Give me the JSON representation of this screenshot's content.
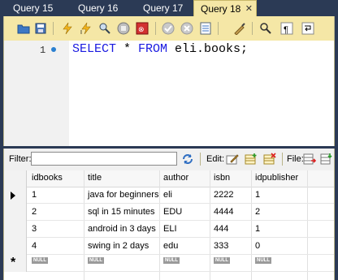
{
  "tabs": [
    {
      "label": "Query 15",
      "active": false
    },
    {
      "label": "Query 16",
      "active": false
    },
    {
      "label": "Query 17",
      "active": false
    },
    {
      "label": "Query 18",
      "active": true
    }
  ],
  "editor": {
    "line_number": "1",
    "code_keyword_select": "SELECT",
    "code_star": " * ",
    "code_keyword_from": "FROM",
    "code_table": " eli.books;"
  },
  "result": {
    "filter_label": "Filter:",
    "filter_value": "",
    "edit_label": "Edit:",
    "file_label": "File:",
    "columns": [
      "idbooks",
      "title",
      "author",
      "isbn",
      "idpublisher"
    ],
    "rows": [
      [
        "1",
        "java for beginners",
        "eli",
        "2222",
        "1"
      ],
      [
        "2",
        "sql in 15 minutes",
        "EDU",
        "4444",
        "2"
      ],
      [
        "3",
        "android in 3 days",
        "ELI",
        "444",
        "1"
      ],
      [
        "4",
        "swing in 2 days",
        "edu",
        "333",
        "0"
      ]
    ],
    "null_label": "NULL",
    "new_row_marker": "*"
  },
  "icons": {
    "toolbar": [
      "open-folder-icon",
      "save-icon",
      "execute-icon",
      "execute-current-icon",
      "explain-icon",
      "stop-icon",
      "toggle-autocommit-icon",
      "commit-icon",
      "rollback-icon",
      "limit-rows-icon",
      "beautify-icon",
      "find-icon",
      "invisible-chars-icon",
      "wrap-icon"
    ]
  }
}
